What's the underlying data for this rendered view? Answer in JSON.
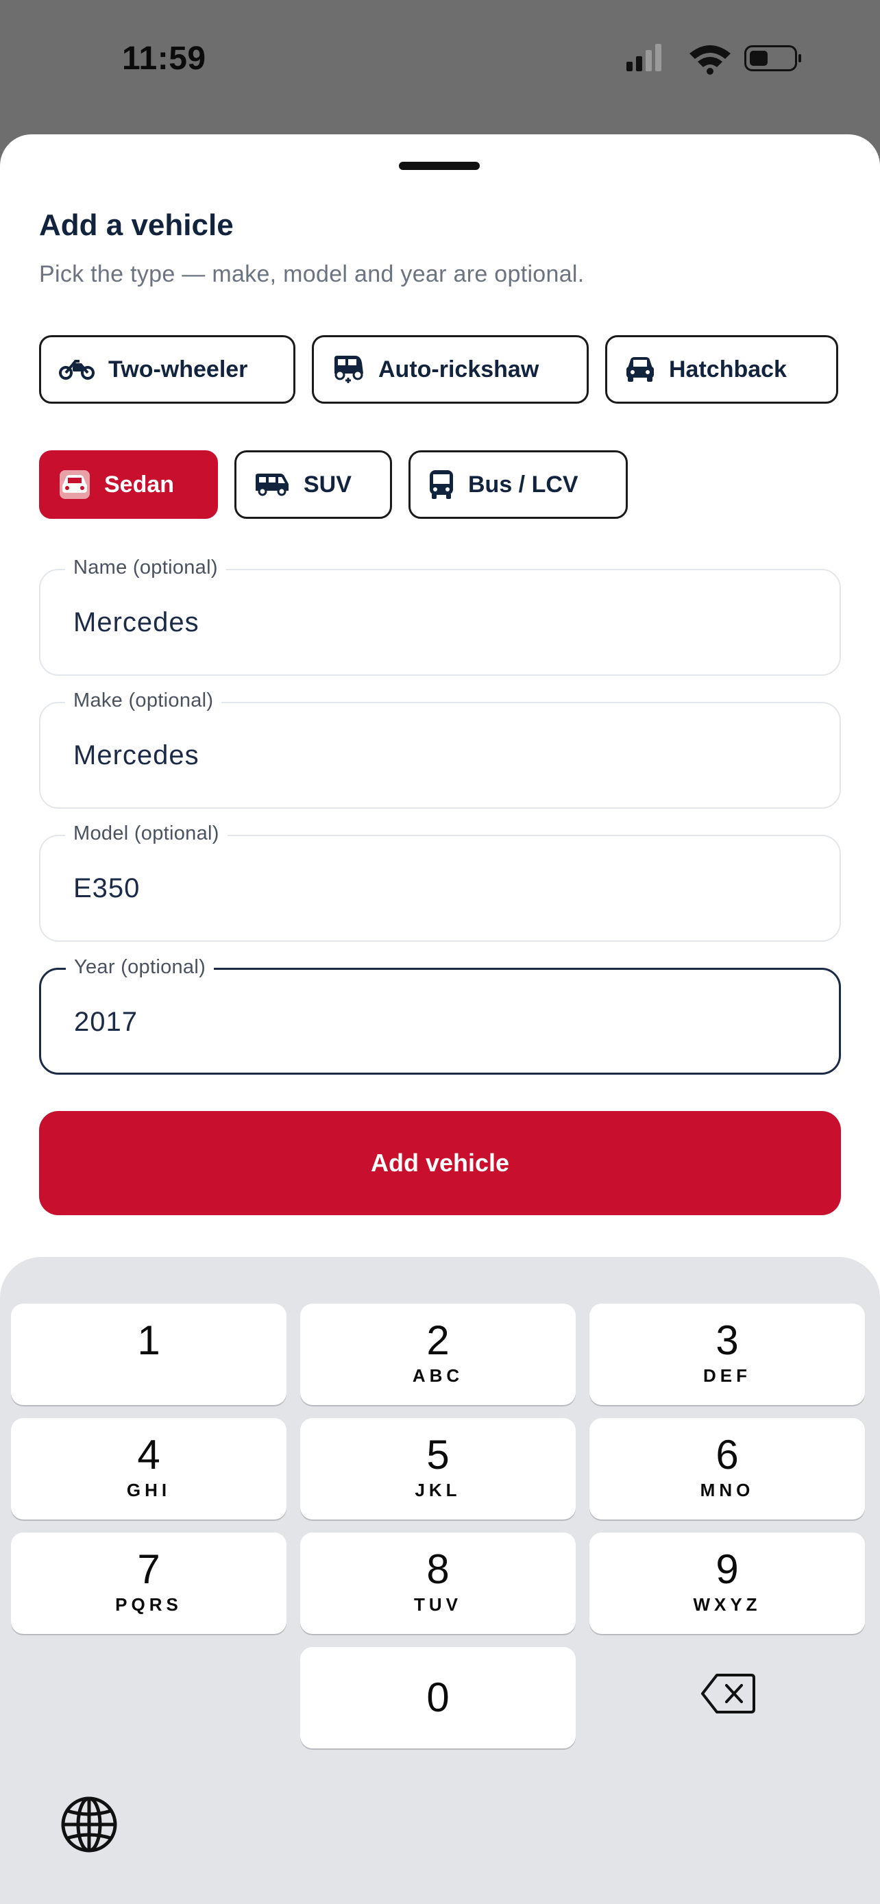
{
  "status_bar": {
    "time": "11:59"
  },
  "sheet": {
    "title": "Add a vehicle",
    "subtitle": "Pick the type — make, model and year are optional.",
    "vehicle_types": [
      {
        "label": "Two-wheeler",
        "icon": "motorcycle-icon",
        "selected": false
      },
      {
        "label": "Auto-rickshaw",
        "icon": "auto-rickshaw-icon",
        "selected": false
      },
      {
        "label": "Hatchback",
        "icon": "car-icon",
        "selected": false
      },
      {
        "label": "Sedan",
        "icon": "sedan-icon",
        "selected": true
      },
      {
        "label": "SUV",
        "icon": "van-icon",
        "selected": false
      },
      {
        "label": "Bus / LCV",
        "icon": "bus-icon",
        "selected": false
      }
    ],
    "fields": {
      "name": {
        "label": "Name (optional)",
        "value": "Mercedes"
      },
      "make": {
        "label": "Make (optional)",
        "value": "Mercedes"
      },
      "model": {
        "label": "Model (optional)",
        "value": "E350"
      },
      "year": {
        "label": "Year (optional)",
        "value": "2017",
        "focused": true
      }
    },
    "submit_label": "Add vehicle"
  },
  "keypad": {
    "keys": [
      {
        "digit": "1",
        "letters": ""
      },
      {
        "digit": "2",
        "letters": "ABC"
      },
      {
        "digit": "3",
        "letters": "DEF"
      },
      {
        "digit": "4",
        "letters": "GHI"
      },
      {
        "digit": "5",
        "letters": "JKL"
      },
      {
        "digit": "6",
        "letters": "MNO"
      },
      {
        "digit": "7",
        "letters": "PQRS"
      },
      {
        "digit": "8",
        "letters": "TUV"
      },
      {
        "digit": "9",
        "letters": "WXYZ"
      },
      {
        "digit": "0",
        "letters": ""
      }
    ],
    "delete_icon": "backspace-icon",
    "globe_icon": "globe-icon"
  },
  "colors": {
    "accent": "#c8102e",
    "text": "#12233d",
    "muted": "#6b7380"
  }
}
